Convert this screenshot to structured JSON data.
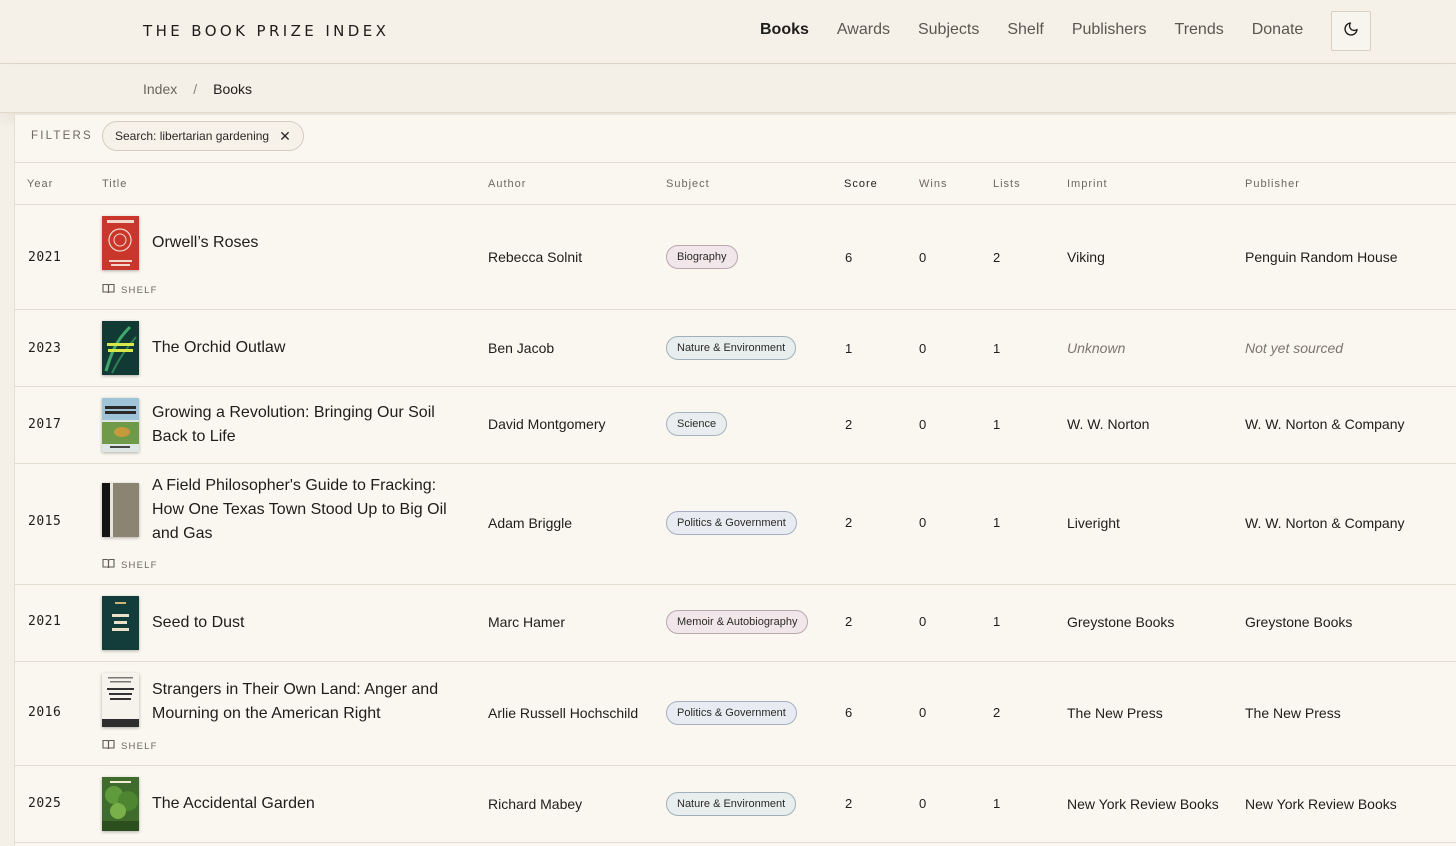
{
  "brand": "THE BOOK PRIZE INDEX",
  "nav": [
    "Books",
    "Awards",
    "Subjects",
    "Shelf",
    "Publishers",
    "Trends",
    "Donate"
  ],
  "nav_active": "Books",
  "breadcrumb": {
    "root": "Index",
    "separator": "/",
    "current": "Books"
  },
  "filters": {
    "label": "FILTERS",
    "chip": "Search: libertarian gardening",
    "chip_close": "✕"
  },
  "columns": {
    "year": "Year",
    "title": "Title",
    "author": "Author",
    "subject": "Subject",
    "score": "Score",
    "wins": "Wins",
    "lists": "Lists",
    "imprint": "Imprint",
    "publisher": "Publisher"
  },
  "shelf_label": "SHELF",
  "rows": [
    {
      "year": "2021",
      "title": "Orwell’s Roses",
      "author": "Rebecca Solnit",
      "subject": "Biography",
      "score": "6",
      "wins": "0",
      "lists": "2",
      "imprint": "Viking",
      "publisher": "Penguin Random House"
    },
    {
      "year": "2023",
      "title": "The Orchid Outlaw",
      "author": "Ben Jacob",
      "subject": "Nature & Environment",
      "score": "1",
      "wins": "0",
      "lists": "1",
      "imprint": "Unknown",
      "publisher": "Not yet sourced"
    },
    {
      "year": "2017",
      "title": "Growing a Revolution: Bringing Our Soil Back to Life",
      "author": "David Montgomery",
      "subject": "Science",
      "score": "2",
      "wins": "0",
      "lists": "1",
      "imprint": "W. W. Norton",
      "publisher": "W. W. Norton & Company"
    },
    {
      "year": "2015",
      "title": "A Field Philosopher's Guide to Fracking: How One Texas Town Stood Up to Big Oil and Gas",
      "author": "Adam Briggle",
      "subject": "Politics & Government",
      "score": "2",
      "wins": "0",
      "lists": "1",
      "imprint": "Liveright",
      "publisher": "W. W. Norton & Company"
    },
    {
      "year": "2021",
      "title": "Seed to Dust",
      "author": "Marc Hamer",
      "subject": "Memoir & Autobiography",
      "score": "2",
      "wins": "0",
      "lists": "1",
      "imprint": "Greystone Books",
      "publisher": "Greystone Books"
    },
    {
      "year": "2016",
      "title": "Strangers in Their Own Land: Anger and Mourning on the American Right",
      "author": "Arlie Russell Hochschild",
      "subject": "Politics & Government",
      "score": "6",
      "wins": "0",
      "lists": "2",
      "imprint": "The New Press",
      "publisher": "The New Press"
    },
    {
      "year": "2025",
      "title": "The Accidental Garden",
      "author": "Richard Mabey",
      "subject": "Nature & Environment",
      "score": "2",
      "wins": "0",
      "lists": "1",
      "imprint": "New York Review Books",
      "publisher": "New York Review Books"
    }
  ]
}
